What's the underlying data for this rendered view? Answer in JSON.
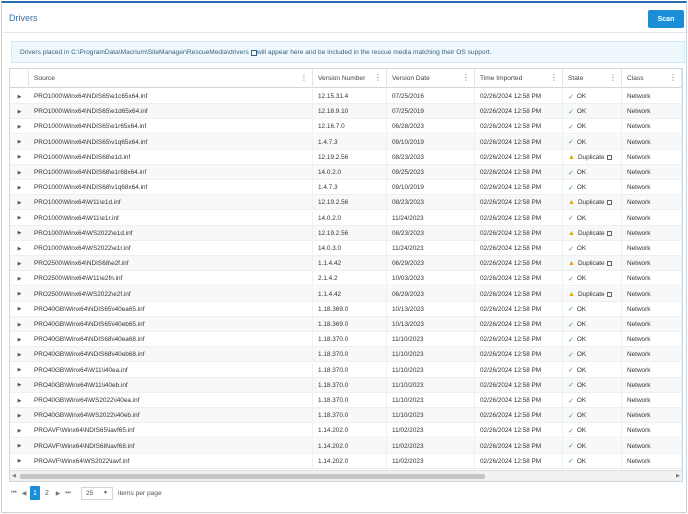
{
  "title": "Drivers",
  "scan_label": "Scan",
  "info": {
    "prefix": "Drivers placed in ",
    "path": "C:\\ProgramData\\Macrium\\SiteManager\\RescueMedia\\drivers",
    "suffix": " will appear here and be included in the rescue media matching their OS support."
  },
  "columns": [
    "Source",
    "Version Number",
    "Version Date",
    "Time Imported",
    "State",
    "Class"
  ],
  "rows": [
    {
      "source": "PRO1000\\Winx64\\NDIS65\\e1c65x64.inf",
      "version": "12.15.31.4",
      "date": "07/25/2016",
      "imported": "02/26/2024 12:58 PM",
      "state": "OK",
      "class": "Network"
    },
    {
      "source": "PRO1000\\Winx64\\NDIS65\\e1d65x64.inf",
      "version": "12.18.9.10",
      "date": "07/25/2019",
      "imported": "02/26/2024 12:58 PM",
      "state": "OK",
      "class": "Network"
    },
    {
      "source": "PRO1000\\Winx64\\NDIS65\\e1r65x64.inf",
      "version": "12.16.7.0",
      "date": "06/28/2023",
      "imported": "02/26/2024 12:58 PM",
      "state": "OK",
      "class": "Network"
    },
    {
      "source": "PRO1000\\Winx64\\NDIS65\\v1q65x64.inf",
      "version": "1.4.7.3",
      "date": "09/10/2019",
      "imported": "02/26/2024 12:58 PM",
      "state": "OK",
      "class": "Network"
    },
    {
      "source": "PRO1000\\Winx64\\NDIS68\\e1d.inf",
      "version": "12.19.2.56",
      "date": "08/23/2023",
      "imported": "02/26/2024 12:58 PM",
      "state": "Duplicate",
      "class": "Network"
    },
    {
      "source": "PRO1000\\Winx64\\NDIS68\\e1r68x64.inf",
      "version": "14.0.2.0",
      "date": "09/25/2023",
      "imported": "02/26/2024 12:58 PM",
      "state": "OK",
      "class": "Network"
    },
    {
      "source": "PRO1000\\Winx64\\NDIS68\\v1q68x64.inf",
      "version": "1.4.7.3",
      "date": "09/10/2019",
      "imported": "02/26/2024 12:58 PM",
      "state": "OK",
      "class": "Network"
    },
    {
      "source": "PRO1000\\Winx64\\W11\\e1d.inf",
      "version": "12.19.2.56",
      "date": "08/23/2023",
      "imported": "02/26/2024 12:58 PM",
      "state": "Duplicate",
      "class": "Network"
    },
    {
      "source": "PRO1000\\Winx64\\W11\\e1r.inf",
      "version": "14.0.2.0",
      "date": "11/24/2023",
      "imported": "02/26/2024 12:58 PM",
      "state": "OK",
      "class": "Network"
    },
    {
      "source": "PRO1000\\Winx64\\WS2022\\e1d.inf",
      "version": "12.19.2.56",
      "date": "08/23/2023",
      "imported": "02/26/2024 12:58 PM",
      "state": "Duplicate",
      "class": "Network"
    },
    {
      "source": "PRO1000\\Winx64\\WS2022\\e1r.inf",
      "version": "14.0.3.0",
      "date": "11/24/2023",
      "imported": "02/26/2024 12:58 PM",
      "state": "OK",
      "class": "Network"
    },
    {
      "source": "PRO2500\\Winx64\\NDIS68\\e2f.inf",
      "version": "1.1.4.42",
      "date": "06/29/2023",
      "imported": "02/26/2024 12:58 PM",
      "state": "Duplicate",
      "class": "Network"
    },
    {
      "source": "PRO2500\\Winx64\\W11\\e2fn.inf",
      "version": "2.1.4.2",
      "date": "10/03/2023",
      "imported": "02/26/2024 12:58 PM",
      "state": "OK",
      "class": "Network"
    },
    {
      "source": "PRO2500\\Winx64\\WS2022\\e2f.inf",
      "version": "1.1.4.42",
      "date": "06/29/2023",
      "imported": "02/26/2024 12:58 PM",
      "state": "Duplicate",
      "class": "Network"
    },
    {
      "source": "PRO40GB\\Winx64\\NDIS65\\i40ea65.inf",
      "version": "1.18.369.0",
      "date": "10/13/2023",
      "imported": "02/26/2024 12:58 PM",
      "state": "OK",
      "class": "Network"
    },
    {
      "source": "PRO40GB\\Winx64\\NDIS65\\i40eb65.inf",
      "version": "1.18.369.0",
      "date": "10/13/2023",
      "imported": "02/26/2024 12:58 PM",
      "state": "OK",
      "class": "Network"
    },
    {
      "source": "PRO40GB\\Winx64\\NDIS68\\i40ea68.inf",
      "version": "1.18.370.0",
      "date": "11/10/2023",
      "imported": "02/26/2024 12:58 PM",
      "state": "OK",
      "class": "Network"
    },
    {
      "source": "PRO40GB\\Winx64\\NDIS68\\i40eb68.inf",
      "version": "1.18.370.0",
      "date": "11/10/2023",
      "imported": "02/26/2024 12:58 PM",
      "state": "OK",
      "class": "Network"
    },
    {
      "source": "PRO40GB\\Winx64\\W11\\i40ea.inf",
      "version": "1.18.370.0",
      "date": "11/10/2023",
      "imported": "02/26/2024 12:58 PM",
      "state": "OK",
      "class": "Network"
    },
    {
      "source": "PRO40GB\\Winx64\\W11\\i40eb.inf",
      "version": "1.18.370.0",
      "date": "11/10/2023",
      "imported": "02/26/2024 12:58 PM",
      "state": "OK",
      "class": "Network"
    },
    {
      "source": "PRO40GB\\Winx64\\WS2022\\i40ea.inf",
      "version": "1.18.370.0",
      "date": "11/10/2023",
      "imported": "02/26/2024 12:58 PM",
      "state": "OK",
      "class": "Network"
    },
    {
      "source": "PRO40GB\\Winx64\\WS2022\\i40eb.inf",
      "version": "1.18.370.0",
      "date": "11/10/2023",
      "imported": "02/26/2024 12:58 PM",
      "state": "OK",
      "class": "Network"
    },
    {
      "source": "PROAVF\\Winx64\\NDIS65\\iavf65.inf",
      "version": "1.14.202.0",
      "date": "11/02/2023",
      "imported": "02/26/2024 12:58 PM",
      "state": "OK",
      "class": "Network"
    },
    {
      "source": "PROAVF\\Winx64\\NDIS68\\iavf68.inf",
      "version": "1.14.202.0",
      "date": "11/02/2023",
      "imported": "02/26/2024 12:58 PM",
      "state": "OK",
      "class": "Network"
    },
    {
      "source": "PROAVF\\Winx64\\WS2022\\iavf.inf",
      "version": "1.14.202.0",
      "date": "11/02/2023",
      "imported": "02/26/2024 12:58 PM",
      "state": "OK",
      "class": "Network"
    }
  ],
  "pager": {
    "pages": [
      "1",
      "2"
    ],
    "current_page": "1",
    "page_size": "25",
    "items_per_page_label": "items per page"
  },
  "colors": {
    "accent": "#1a8fd8",
    "ok": "#3aa35a",
    "warning": "#e9a400",
    "title": "#3a6ea5"
  }
}
